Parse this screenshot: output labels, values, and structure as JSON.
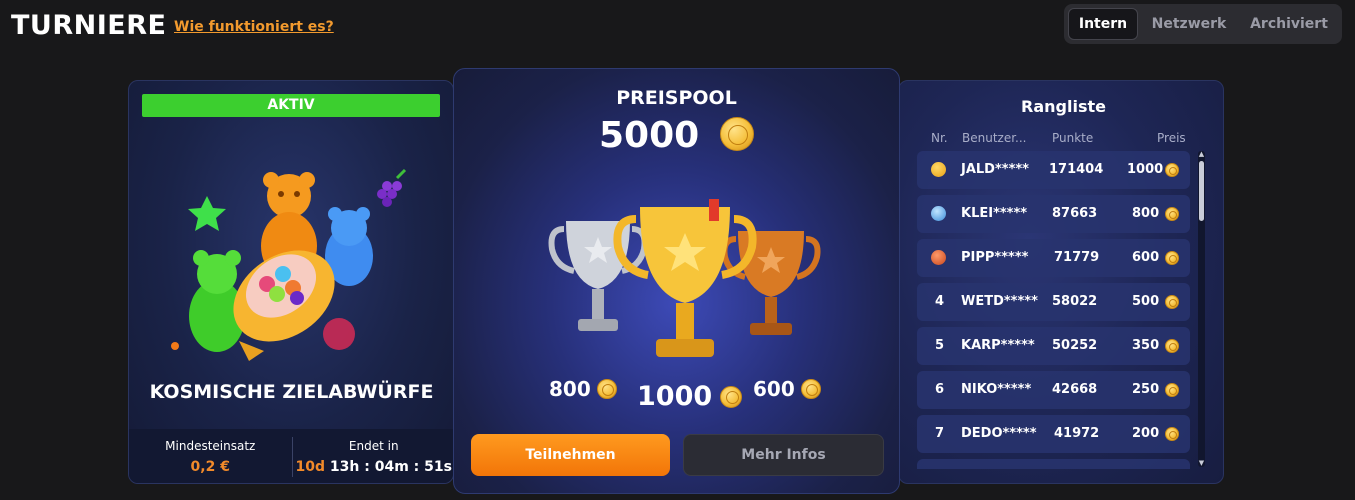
{
  "header": {
    "title": "TURNIERE",
    "how_link": "Wie funktioniert es?",
    "tabs": [
      {
        "label": "Intern",
        "active": true
      },
      {
        "label": "Netzwerk",
        "active": false
      },
      {
        "label": "Archiviert",
        "active": false
      }
    ]
  },
  "tournament": {
    "status": "AKTIV",
    "name": "KOSMISCHE ZIELABWÜRFE",
    "min_bet_label": "Mindesteinsatz",
    "min_bet_value": "0,2 €",
    "ends_label": "Endet in",
    "ends_days": "10d",
    "ends_time": "13h : 04m :  51s",
    "colors": {
      "active": "#3ccf2f",
      "accent": "#f28a2a"
    }
  },
  "prizepool": {
    "label": "PREISPOOL",
    "amount": "5000",
    "second": "800",
    "first": "1000",
    "third": "600",
    "join_button": "Teilnehmen",
    "info_button": "Mehr Infos"
  },
  "leaderboard": {
    "title": "Rangliste",
    "columns": [
      "Nr.",
      "Benutzer...",
      "Punkte",
      "Preis"
    ],
    "rows": [
      {
        "rank": "",
        "medal": "gold-medal-icon",
        "user": "JALD*****",
        "points": "171404",
        "prize": "1000"
      },
      {
        "rank": "",
        "medal": "silver-medal-icon",
        "user": "KLEI*****",
        "points": "87663",
        "prize": "800"
      },
      {
        "rank": "",
        "medal": "bronze-medal-icon",
        "user": "PIPP*****",
        "points": "71779",
        "prize": "600"
      },
      {
        "rank": "4",
        "medal": "",
        "user": "WETD*****",
        "points": "58022",
        "prize": "500"
      },
      {
        "rank": "5",
        "medal": "",
        "user": "KARP*****",
        "points": "50252",
        "prize": "350"
      },
      {
        "rank": "6",
        "medal": "",
        "user": "NIKO*****",
        "points": "42668",
        "prize": "250"
      },
      {
        "rank": "7",
        "medal": "",
        "user": "DEDO*****",
        "points": "41972",
        "prize": "200"
      }
    ]
  }
}
